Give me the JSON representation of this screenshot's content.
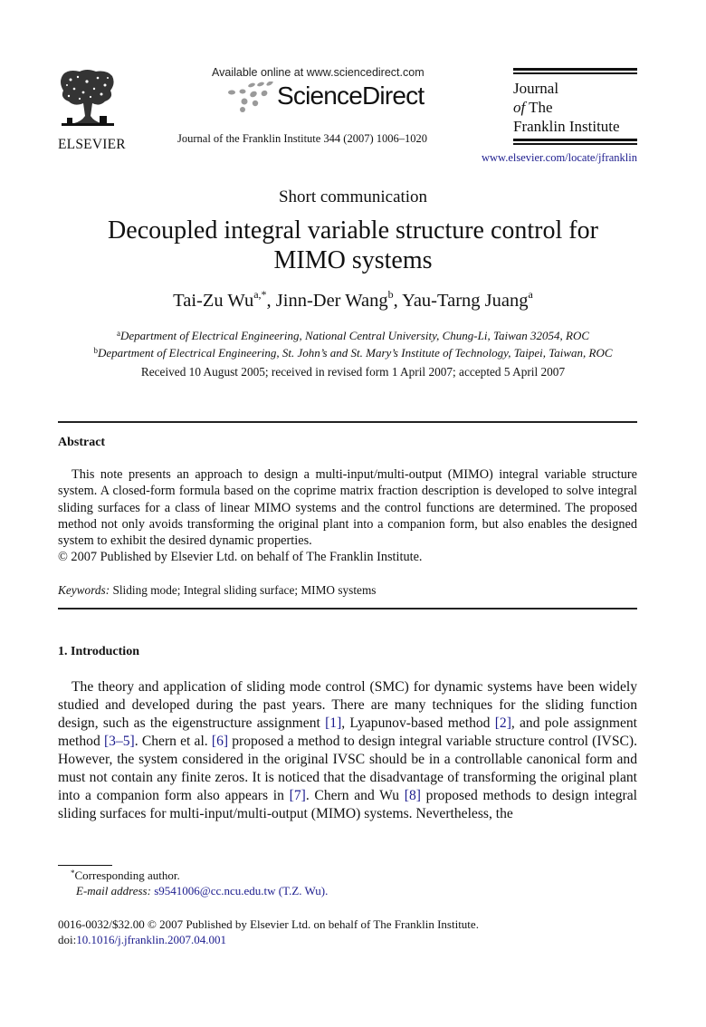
{
  "header": {
    "publisher_logo_text": "ELSEVIER",
    "availability_text": "Available online at www.sciencedirect.com",
    "platform_logo_text": "ScienceDirect",
    "journal_citation": "Journal of the Franklin Institute 344 (2007) 1006–1020",
    "journal_logo": {
      "line1": "Journal",
      "line2_italic": "of",
      "line2_rest": " The",
      "line3": "Franklin Institute"
    },
    "journal_url": "www.elsevier.com/locate/jfranklin"
  },
  "article": {
    "section_type": "Short communication",
    "title_line1": "Decoupled integral variable structure control for",
    "title_line2": "MIMO systems",
    "authors": [
      {
        "name": "Tai-Zu Wu",
        "sup": "a,*",
        "sep": ", "
      },
      {
        "name": "Jinn-Der Wang",
        "sup": "b",
        "sep": ", "
      },
      {
        "name": "Yau-Tarng Juang",
        "sup": "a",
        "sep": ""
      }
    ],
    "affiliations": [
      {
        "mark": "a",
        "text": "Department of Electrical Engineering, National Central University, Chung-Li, Taiwan 32054, ROC"
      },
      {
        "mark": "b",
        "text": "Department of Electrical Engineering, St. John’s and St. Mary’s Institute of Technology, Taipei, Taiwan, ROC"
      }
    ],
    "received": "Received 10 August 2005; received in revised form 1 April 2007; accepted 5 April 2007"
  },
  "abstract": {
    "heading": "Abstract",
    "body": "This note presents an approach to design a multi-input/multi-output (MIMO) integral variable structure system. A closed-form formula based on the coprime matrix fraction description is developed to solve integral sliding surfaces for a class of linear MIMO systems and the control functions are determined. The proposed method not only avoids transforming the original plant into a companion form, but also enables the designed system to exhibit the desired dynamic properties.",
    "copyright": "© 2007 Published by Elsevier Ltd. on behalf of The Franklin Institute.",
    "keywords_label": "Keywords:",
    "keywords": "Sliding mode; Integral sliding surface; MIMO systems"
  },
  "introduction": {
    "heading": "1.  Introduction",
    "segments": [
      {
        "t": "The theory and application of sliding mode control (SMC) for dynamic systems have been widely studied and developed during the past years. There are many techniques for the sliding function design, such as the eigenstructure assignment "
      },
      {
        "t": "[1]",
        "link": true
      },
      {
        "t": ", Lyapunov-based method "
      },
      {
        "t": "[2]",
        "link": true
      },
      {
        "t": ", and pole assignment method "
      },
      {
        "t": "[3–5]",
        "link": true
      },
      {
        "t": ". Chern et al. "
      },
      {
        "t": "[6]",
        "link": true
      },
      {
        "t": " proposed a method to design integral variable structure control (IVSC). However, the system considered in the original IVSC should be in a controllable canonical form and must not contain any finite zeros. It is noticed that the disadvantage of transforming the original plant into a companion form also appears in "
      },
      {
        "t": "[7]",
        "link": true
      },
      {
        "t": ". Chern and Wu "
      },
      {
        "t": "[8]",
        "link": true
      },
      {
        "t": " proposed methods to design integral sliding surfaces for multi-input/multi-output (MIMO) systems. Nevertheless, the"
      }
    ]
  },
  "footnotes": {
    "corresponding_mark": "*",
    "corresponding_text": "Corresponding author.",
    "email_label": "E-mail address:",
    "email": "s9541006@cc.ncu.edu.tw (T.Z. Wu).",
    "issn_line": "0016-0032/$32.00 © 2007 Published by Elsevier Ltd. on behalf of The Franklin Institute.",
    "doi_label": "doi:",
    "doi": "10.1016/j.jfranklin.2007.04.001"
  },
  "colors": {
    "link": "#1c1c8e",
    "text": "#111111",
    "logo_dots": "#9a9a9a"
  }
}
